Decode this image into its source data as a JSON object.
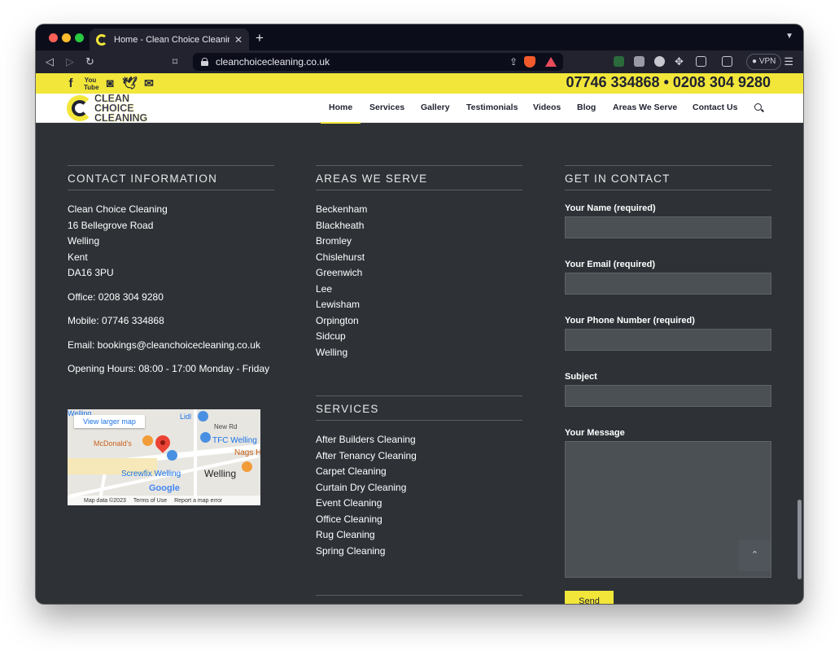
{
  "browser": {
    "tab_title": "Home - Clean Choice Cleaning",
    "url": "cleanchoicecleaning.co.uk",
    "vpn_label": "VPN",
    "badge_count": "9"
  },
  "header": {
    "phones": "07746 334868 • 0208 304 9280",
    "logo_lines": [
      "CLEAN",
      "CHOICE",
      "CLEANING"
    ],
    "social_icons": [
      "facebook-icon",
      "youtube-icon",
      "instagram-icon",
      "twitter-icon",
      "email-icon"
    ],
    "nav": [
      "Home",
      "Services",
      "Gallery",
      "Testimonials",
      "Videos",
      "Blog",
      "Areas We Serve",
      "Contact Us"
    ]
  },
  "contact": {
    "title": "CONTACT INFORMATION",
    "address": [
      "Clean Choice Cleaning",
      "16 Bellegrove Road",
      "Welling",
      "Kent",
      "DA16 3PU"
    ],
    "office": "Office: 0208 304 9280",
    "mobile": "Mobile: 07746 334868",
    "email": "Email: bookings@cleanchoicecleaning.co.uk",
    "hours": "Opening Hours: 08:00 - 17:00 Monday - Friday"
  },
  "map": {
    "view_larger": "View larger map",
    "labels": [
      "Welling",
      "Lidl",
      "New Rd",
      "McDonald's",
      "TFC Welling",
      "Nags H",
      "Screwfix Welling",
      "Welling"
    ],
    "google": "Google",
    "footer": [
      "Map data ©2023",
      "Terms of Use",
      "Report a map error"
    ]
  },
  "areas": {
    "title": "AREAS WE SERVE",
    "items": [
      "Beckenham",
      "Blackheath",
      "Bromley",
      "Chislehurst",
      "Greenwich",
      "Lee",
      "Lewisham",
      "Orpington",
      "Sidcup",
      "Welling"
    ]
  },
  "services": {
    "title": "SERVICES",
    "items": [
      "After Builders Cleaning",
      "After Tenancy Cleaning",
      "Carpet Cleaning",
      "Curtain Dry Cleaning",
      "Event Cleaning",
      "Office Cleaning",
      "Rug Cleaning",
      "Spring Cleaning"
    ]
  },
  "form": {
    "title": "GET IN CONTACT",
    "name_label": "Your Name (required)",
    "email_label": "Your Email (required)",
    "phone_label": "Your Phone Number (required)",
    "subject_label": "Subject",
    "message_label": "Your Message",
    "send": "Send"
  }
}
